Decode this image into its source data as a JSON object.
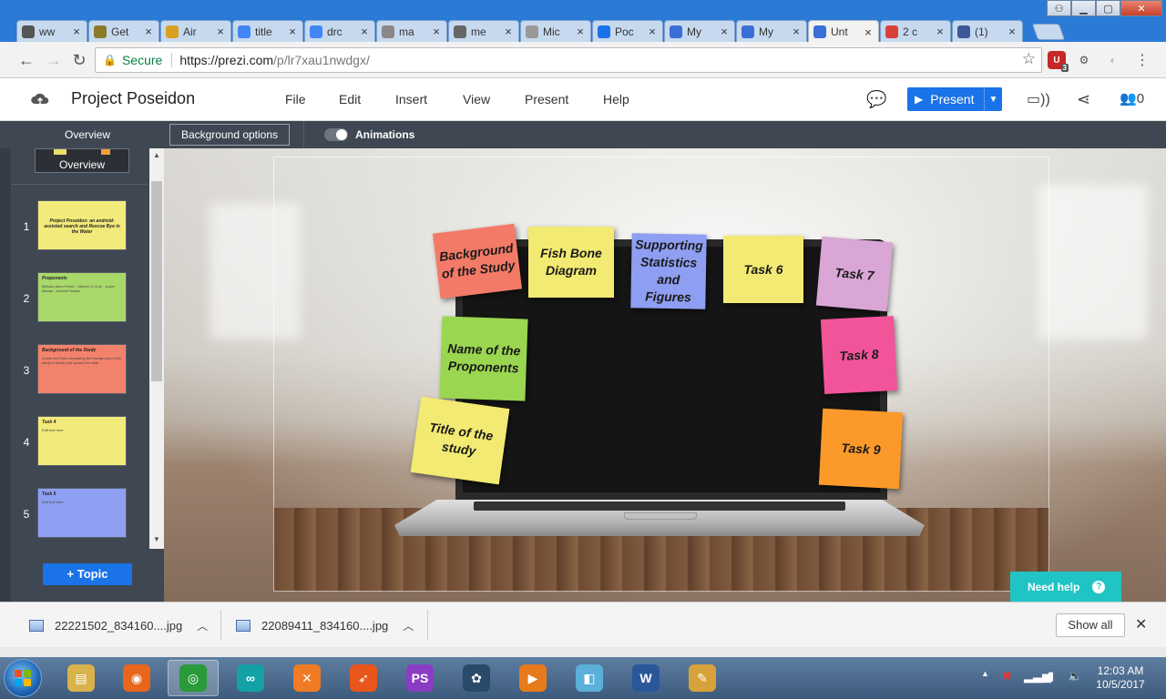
{
  "browser": {
    "tabs": [
      {
        "label": "ww",
        "icon": "mask-icon",
        "color": "#555555"
      },
      {
        "label": "Get",
        "icon": "logo-icon",
        "color": "#8a7a2a"
      },
      {
        "label": "Air",
        "icon": "airline-icon",
        "color": "#d8a020"
      },
      {
        "label": "title",
        "icon": "google-icon",
        "color": "#4285f4"
      },
      {
        "label": "drc",
        "icon": "google-icon",
        "color": "#4285f4"
      },
      {
        "label": "ma",
        "icon": "gmail-icon",
        "color": "#888888"
      },
      {
        "label": "me",
        "icon": "facts-icon",
        "color": "#666666"
      },
      {
        "label": "Mic",
        "icon": "page-icon",
        "color": "#999999"
      },
      {
        "label": "Poc",
        "icon": "blue-circle-icon",
        "color": "#1a73e8"
      },
      {
        "label": "My",
        "icon": "prezi-icon",
        "color": "#3a6fd8"
      },
      {
        "label": "My",
        "icon": "prezi-icon",
        "color": "#3a6fd8"
      },
      {
        "label": "Unt",
        "icon": "prezi-icon",
        "color": "#3a6fd8"
      },
      {
        "label": "2 c",
        "icon": "swirl-icon",
        "color": "#d8403a"
      },
      {
        "label": "(1)",
        "icon": "facebook-icon",
        "color": "#3b5998"
      }
    ],
    "secure_label": "Secure",
    "url_host": "https://prezi.com",
    "url_path": "/p/lr7xau1nwdgx/",
    "ext_badge": "3"
  },
  "prezi": {
    "title": "Project Poseidon",
    "menu": [
      "File",
      "Edit",
      "Insert",
      "View",
      "Present",
      "Help"
    ],
    "present_label": "Present",
    "collab_count": "0"
  },
  "toolbar": {
    "overview_label": "Overview",
    "background_options": "Background options",
    "animations_label": "Animations"
  },
  "sidebar": {
    "overview_thumb_label": "Overview",
    "slides": [
      {
        "num": "1",
        "color": "#f2ea7a",
        "title": "Project Poseidon: an android-assisted search and Rescue Bye in the Water",
        "body": ""
      },
      {
        "num": "2",
        "color": "#a9d86a",
        "title": "Proponents",
        "body": "Mitsuko Aciro Ferrer · Alberto Jr Cruz · Joyce Manila · Jaroniel Daniel"
      },
      {
        "num": "3",
        "color": "#f2826c",
        "title": "Background of the Study",
        "body": "Lorem text lines describing the background of the study in small print across the slide."
      },
      {
        "num": "4",
        "color": "#f2ea7a",
        "title": "Task 4",
        "body": "Edit text here"
      },
      {
        "num": "5",
        "color": "#8fa0f2",
        "title": "Task 5",
        "body": "Edit text here"
      }
    ],
    "topic_button": "+ Topic"
  },
  "canvas": {
    "notes": [
      {
        "text": "Background of the Study",
        "color": "#f47a68"
      },
      {
        "text": "Fish Bone Diagram",
        "color": "#f2ea72"
      },
      {
        "text": "Supporting Statistics and Figures",
        "color": "#8e9ef2"
      },
      {
        "text": "Task 6",
        "color": "#f2ea72"
      },
      {
        "text": "Task 7",
        "color": "#d9a6d6"
      },
      {
        "text": "Name of the Proponents",
        "color": "#9ad650"
      },
      {
        "text": "Task 8",
        "color": "#f2549a"
      },
      {
        "text": "Title of the study",
        "color": "#f2ea72"
      },
      {
        "text": "Task 9",
        "color": "#fb9a2a"
      }
    ],
    "need_help": "Need help",
    "need_help_icon": "?"
  },
  "downloads": {
    "items": [
      "22221502_834160....jpg",
      "22089411_834160....jpg"
    ],
    "show_all": "Show all"
  },
  "taskbar": {
    "apps": [
      {
        "name": "explorer",
        "glyph": "▤",
        "color": "#d8b24a"
      },
      {
        "name": "firefox",
        "glyph": "◉",
        "color": "#e8661c"
      },
      {
        "name": "chrome",
        "glyph": "◎",
        "color": "#2a9a3a"
      },
      {
        "name": "arduino",
        "glyph": "∞",
        "color": "#13a1a6"
      },
      {
        "name": "xampp",
        "glyph": "✕",
        "color": "#f07b24"
      },
      {
        "name": "rocket",
        "glyph": "➶",
        "color": "#e8561c"
      },
      {
        "name": "phpstorm",
        "glyph": "PS",
        "color": "#8a3cc4"
      },
      {
        "name": "tree-app",
        "glyph": "✿",
        "color": "#2a4a6a"
      },
      {
        "name": "video-app",
        "glyph": "▶",
        "color": "#e87a1c"
      },
      {
        "name": "notebook-app",
        "glyph": "◧",
        "color": "#5ab0d8"
      },
      {
        "name": "word",
        "glyph": "W",
        "color": "#2b579a"
      },
      {
        "name": "paint",
        "glyph": "✎",
        "color": "#d8a23a"
      }
    ],
    "time": "12:03 AM",
    "date": "10/5/2017"
  }
}
